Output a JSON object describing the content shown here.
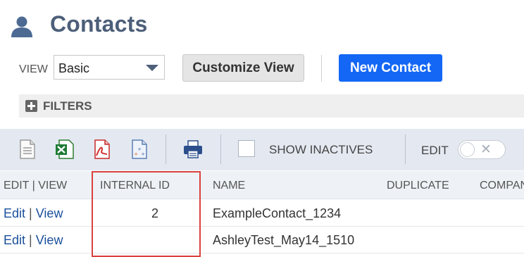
{
  "header": {
    "title": "Contacts",
    "icon": "person-icon"
  },
  "view": {
    "label": "VIEW",
    "selected": "Basic",
    "customize_label": "Customize View",
    "new_label": "New Contact"
  },
  "filters": {
    "label": "FILTERS"
  },
  "toolbar": {
    "icons": [
      "document-icon",
      "excel-icon",
      "pdf-icon",
      "csv-icon",
      "print-icon"
    ],
    "show_inactives_label": "SHOW INACTIVES",
    "edit_label": "EDIT",
    "edit_toggle_on": false
  },
  "table": {
    "columns": {
      "edit_view": "EDIT | VIEW",
      "internal_id": "INTERNAL ID",
      "name": "NAME",
      "duplicate": "DUPLICATE",
      "company": "COMPAN"
    },
    "rows": [
      {
        "edit": "Edit",
        "sep": "|",
        "view": "View",
        "internal_id": "2",
        "name": "ExampleContact_1234"
      },
      {
        "edit": "Edit",
        "sep": "|",
        "view": "View",
        "internal_id": "",
        "name": "AshleyTest_May14_1510"
      }
    ]
  },
  "colors": {
    "title": "#4d5f79",
    "primary_button": "#1467f5",
    "toolbar_bg": "#e4e9f1",
    "link": "#1a4f9c",
    "highlight": "#d9423f"
  }
}
